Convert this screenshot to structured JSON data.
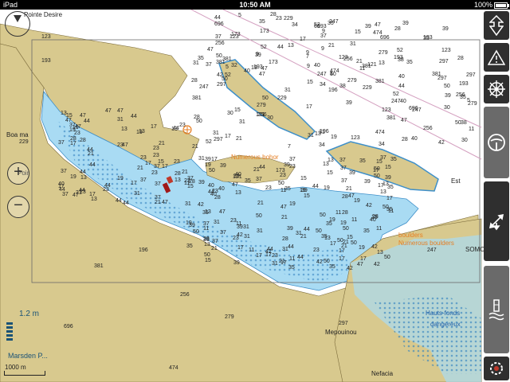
{
  "status": {
    "device": "iPad",
    "time": "10:50 AM",
    "battery": "100%"
  },
  "places": {
    "pointe_desire": "Pointe Desire",
    "boa_ma": "Boa ma",
    "poir": "Poir",
    "mepouinou": "Mepouinou",
    "nefacia": "Nefacia",
    "somo": "SOMO",
    "est": "Est",
    "marsden": "Marsden P..."
  },
  "annotations": {
    "numerous_boulders_1": "Numerous bohor",
    "boulders": "boulders",
    "numerous_boulders_2": "Numerous boulders",
    "hauts_fonds": "Hauts-fonds",
    "dangereux": "dangereux"
  },
  "depth_soundings": [
    "123",
    "193",
    "229",
    "381",
    "196",
    "256",
    "279",
    "696",
    "474",
    "297",
    "247",
    "121",
    "173",
    "35",
    "42",
    "39",
    "50",
    "28",
    "37",
    "47",
    "44",
    "40",
    "31",
    "23",
    "21",
    "17",
    "19",
    "15",
    "13",
    "11",
    "9",
    "7",
    "5",
    "30",
    "34",
    "32",
    "38",
    "52",
    "60"
  ],
  "land_heights": [
    "123",
    "193",
    "229",
    "381",
    "196",
    "256",
    "279",
    "696",
    "474",
    "297",
    "247"
  ],
  "scale": {
    "depth_value": "1.2 m",
    "distance_label": "1000 m"
  },
  "colors": {
    "land": "#d8c98e",
    "shallow": "#a9dbf3",
    "deep": "#ffffff",
    "reef": "#3e8fc9",
    "accent": "#c0392b"
  },
  "toolbar": [
    "route-icon",
    "warning-icon",
    "helm-icon",
    "steering-wheel-icon",
    "move-icon",
    "tide-icon",
    "settings-icon"
  ]
}
